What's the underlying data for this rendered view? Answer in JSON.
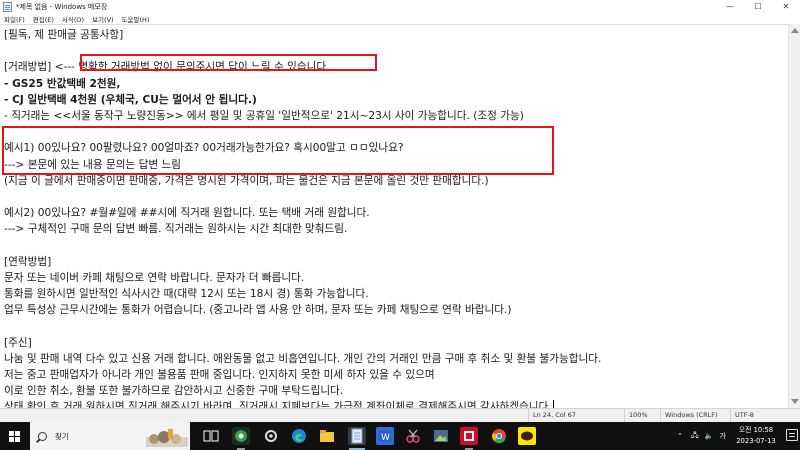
{
  "window": {
    "title": "*제목 없음 - Windows 메모장",
    "min_glyph": "—",
    "max_glyph": "☐",
    "close_glyph": "✕"
  },
  "menu": [
    "파일(F)",
    "편집(E)",
    "서식(O)",
    "보기(V)",
    "도움말(H)"
  ],
  "document": {
    "lines": [
      "[필독, 제 판매글 공통사항]",
      "",
      "[거래방법] <--- 명확한 거래방법 없이 문의주시면 답이 느릴 수 있습니다.",
      "- GS25 반값택배 2천원,",
      "- CJ 일반택배 4천원 (우체국, CU는 멀어서 안 됩니다.)",
      "- 직거래는 <<서울 동작구 노량진동>> 에서 평일 및 공휴일 '일반적으로' 21시~23시 사이 가능합니다. (조정 가능)",
      "",
      "예시1) 00있나요? 00팔렸나요? 00얼마죠? 00거래가능한가요? 혹시00말고 ㅁㅁ있나요?",
      "---> 본문에 있는 내용 문의는 답변 느림",
      "(지금 이 글에서 판매중이면 판매중, 가격은 명시된 가격이며, 파는 물건은 지금 본문에 올린 것만 판매합니다.)",
      "",
      "예시2) 00있나요? #월#일에 ##시에 직거래 원합니다. 또는 택배 거래 원합니다.",
      "---> 구체적인 구매 문의 답변 빠름. 직거래는 원하시는 시간 최대한 맞춰드림.",
      "",
      "[연락방법]",
      "문자 또는 네이버 카페 채팅으로 연락 바랍니다. 문자가 더 빠릅니다.",
      "통화를 원하시면 일반적인 식사시간 때(대략 12시 또는 18시 경) 통화 가능합니다.",
      "업무 특성상 근무시간에는 통화가 어렵습니다. (중고나라 앱 사용 안 하며, 문자 또는 카페 채팅으로 연락 바랍니다.)",
      "",
      "[주신]",
      "나눔 및 판매 내역 다수 있고 신용 거래 합니다. 애완동물 없고 비흡연입니다. 개인 간의 거래인 만큼 구매 후 취소 및 환불 불가능합니다.",
      "저는 중고 판매업자가 아니라 개인 불용품 판매 중입니다. 인지하지 못한 미세 하자 있을 수 있으며",
      "이로 인한 취소, 환불 또한 불가하므로 감안하시고 신중한 구매 부탁드립니다.",
      "상태 확인 후 거래 원하시면 직거래 해주시기 바라며, 직거래시 지폐보다는 가급적 계좌이체로 결제해주시면 감사하겠습니다."
    ]
  },
  "status": {
    "position": "Ln 24, Col 67",
    "zoom": "100%",
    "line_ending": "Windows (CRLF)",
    "encoding": "UTF-8"
  },
  "taskbar": {
    "search_label": "찾기",
    "tray_lang": "가",
    "time": "오전 10:58",
    "date": "2023-07-13"
  }
}
